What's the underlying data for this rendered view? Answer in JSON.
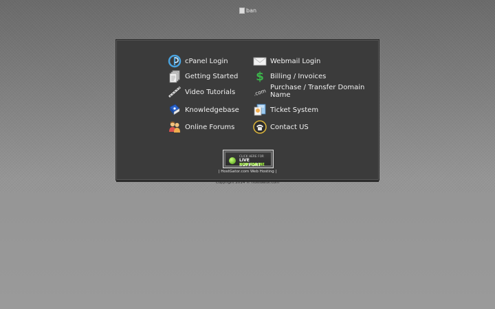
{
  "banner": {
    "alt_text": "ban"
  },
  "links": {
    "left": [
      {
        "label": "cPanel Login",
        "icon": "cpanel-icon"
      },
      {
        "label": "Getting Started",
        "icon": "documents-icon"
      },
      {
        "label": "Video Tutorials",
        "icon": "film-strip-icon"
      },
      {
        "label": "Knowledgebase",
        "icon": "book-icon"
      },
      {
        "label": "Online Forums",
        "icon": "users-icon"
      }
    ],
    "right": [
      {
        "label": "Webmail Login",
        "icon": "envelope-icon"
      },
      {
        "label": "Billing / Invoices",
        "icon": "dollar-icon"
      },
      {
        "label": "Purchase / Transfer Domain Name",
        "icon": "dotcom-icon"
      },
      {
        "label": "Ticket System",
        "icon": "ticket-icon"
      },
      {
        "label": "Contact US",
        "icon": "phone-icon"
      }
    ]
  },
  "support_button": {
    "line1": "CLICK HERE FOR",
    "line2": "LIVE SUPPORT",
    "line3": "NOW ONLINE"
  },
  "hosting_link": "| HostGator.com Web Hosting |",
  "copyright": "Copyright 2014 © HostGator.com",
  "colors": {
    "panel_bg": "#3b3b3b",
    "text": "#f2f2f2",
    "online_green": "#a6ff3a"
  }
}
